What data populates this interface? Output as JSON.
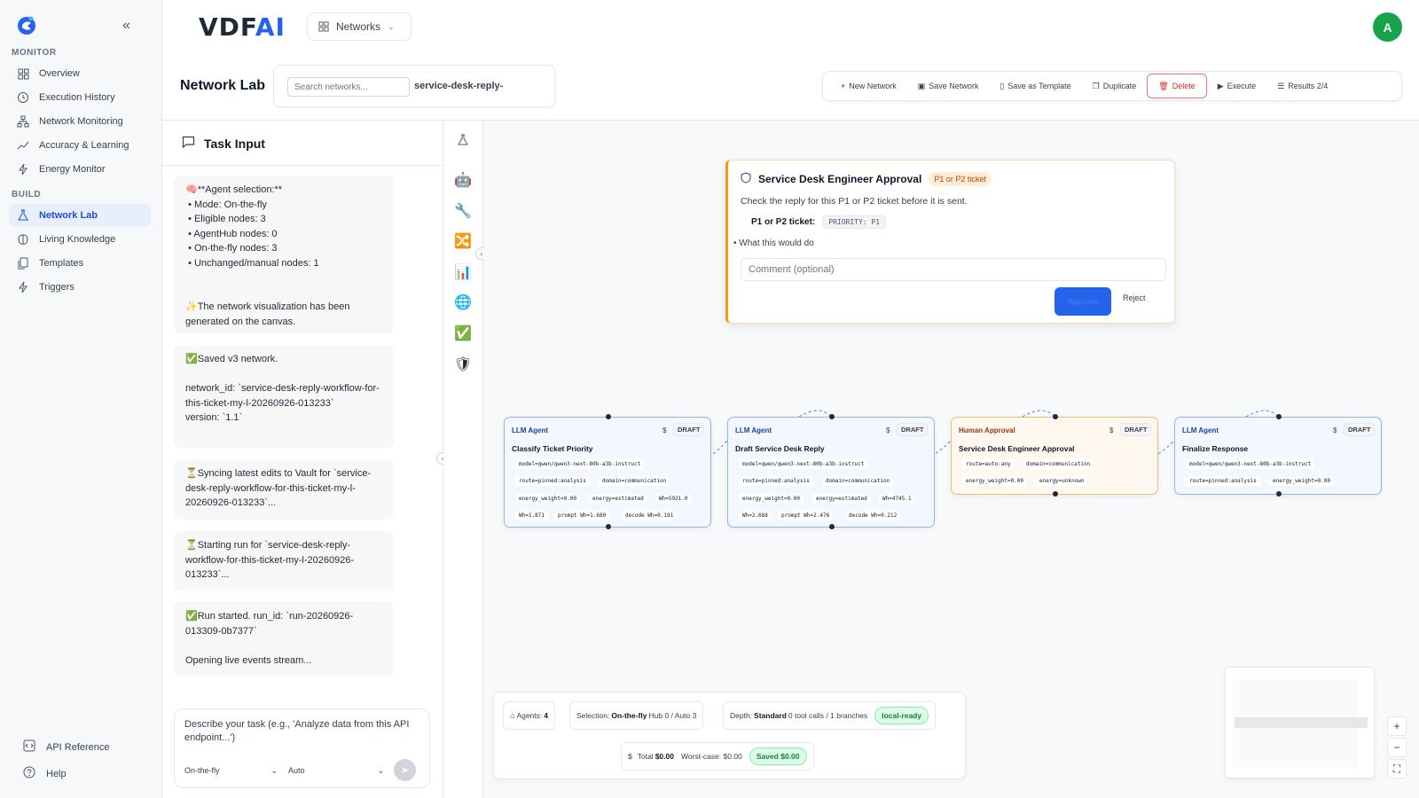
{
  "sidebar": {
    "monitor_label": "MONITOR",
    "build_label": "BUILD",
    "monitor_items": [
      {
        "label": "Overview",
        "icon": "grid-icon"
      },
      {
        "label": "Execution History",
        "icon": "history-icon"
      },
      {
        "label": "Network Monitoring",
        "icon": "network-icon"
      },
      {
        "label": "Accuracy & Learning",
        "icon": "trend-icon"
      },
      {
        "label": "Energy Monitor",
        "icon": "bolt-icon"
      }
    ],
    "build_items": [
      {
        "label": "Network Lab",
        "icon": "flask-icon",
        "active": true
      },
      {
        "label": "Living Knowledge",
        "icon": "brain-icon"
      },
      {
        "label": "Templates",
        "icon": "copy-icon"
      },
      {
        "label": "Triggers",
        "icon": "bolt-icon"
      }
    ],
    "footer_items": [
      {
        "label": "API Reference",
        "icon": "code-icon"
      },
      {
        "label": "Help",
        "icon": "help-icon"
      }
    ]
  },
  "header": {
    "brand_main": "VDF",
    "brand_accent": "AI",
    "networks_dropdown": "Networks",
    "avatar_initial": "A"
  },
  "lab": {
    "title": "Network Lab",
    "search_placeholder": "Search networks...",
    "selected_network": "service-desk-reply-"
  },
  "toolbar": {
    "new_network": "New Network",
    "save_network": "Save Network",
    "save_template": "Save as Template",
    "duplicate": "Duplicate",
    "delete": "Delete",
    "execute": "Execute",
    "results": "Results 2/4"
  },
  "task_panel": {
    "title": "Task Input",
    "messages": [
      "🧠**Agent selection:**\n • Mode: On-the-fly\n • Eligible nodes: 3\n • AgentHub nodes: 0\n • On-the-fly nodes: 3\n • Unchanged/manual nodes: 1\n\n\n✨The network visualization has been generated on the canvas.",
      "✅Saved v3 network.\n\nnetwork_id: `service-desk-reply-workflow-for-this-ticket-my-l-20260926-013233`\nversion: `1.1`",
      "⏳Syncing latest edits to Vault for `service-desk-reply-workflow-for-this-ticket-my-l-20260926-013233`...",
      "⏳Starting run for `service-desk-reply-workflow-for-this-ticket-my-l-20260926-013233`...",
      "✅Run started. run_id: `run-20260926-013309-0b7377`\n\nOpening live events stream..."
    ],
    "composer_placeholder": "Describe your task (e.g., 'Analyze data from this API endpoint...')",
    "mode_value": "On-the-fly",
    "model_value": "Auto"
  },
  "palette": [
    "robot",
    "wrench",
    "shuffle",
    "chart",
    "globe",
    "check",
    "shield"
  ],
  "approval": {
    "title": "Service Desk Engineer Approval",
    "badge": "P1 or P2 ticket",
    "description": "Check the reply for this P1 or P2 ticket before it is sent.",
    "field_label": "P1 or P2 ticket:",
    "field_value": "PRIORITY: P1",
    "what_label": "What this would do",
    "comment_placeholder": "Comment (optional)",
    "approve_label": "Approve",
    "reject_label": "Reject"
  },
  "nodes": [
    {
      "type": "LLM Agent",
      "cost": "$",
      "state": "DRAFT",
      "name": "Classify Ticket Priority",
      "meta": [
        "model=qwen/qwen3-next-80b-a3b-instruct",
        "route=pinned:analysis",
        "domain=communication",
        "energy_weight=0.00",
        "energy=estimated",
        "Wh=5921.0",
        "Wh=1.871",
        "prompt Wh=1.680",
        "decode Wh=0.191"
      ]
    },
    {
      "type": "LLM Agent",
      "cost": "$",
      "state": "DRAFT",
      "name": "Draft Service Desk Reply",
      "meta": [
        "model=qwen/qwen3-next-80b-a3b-instruct",
        "route=pinned:analysis",
        "domain=communication",
        "energy_weight=0.00",
        "energy=estimated",
        "Wh=4745.1",
        "Wh=2.688",
        "prompt Wh=2.476",
        "decode Wh=0.212"
      ]
    },
    {
      "type": "Human Approval",
      "cost": "$",
      "state": "DRAFT",
      "name": "Service Desk Engineer Approval",
      "meta": [
        "route=auto:any",
        "domain=communication",
        "energy_weight=0.00",
        "energy=unknown"
      ]
    },
    {
      "type": "LLM Agent",
      "cost": "$",
      "state": "DRAFT",
      "name": "Finalize Response",
      "meta": [
        "model=qwen/qwen3-next-80b-a3b-instruct",
        "route=pinned:analysis",
        "energy_weight=0.00"
      ]
    }
  ],
  "stats": {
    "agents_label": "Agents:",
    "agents_value": "4",
    "selection_label": "Selection:",
    "selection_value": "On-the-fly",
    "selection_rest": "Hub 0 / Auto 3",
    "depth_label": "Depth:",
    "depth_value": "Standard",
    "depth_rest": "0 tool calls / 1 branches",
    "local_ready": "local-ready",
    "total_label": "Total",
    "total_value": "$0.00",
    "worst_case": "Worst-case: $0.00",
    "saved": "Saved $0.00"
  },
  "zoom": {
    "plus": "+",
    "minus": "−",
    "fit": "⛶"
  }
}
